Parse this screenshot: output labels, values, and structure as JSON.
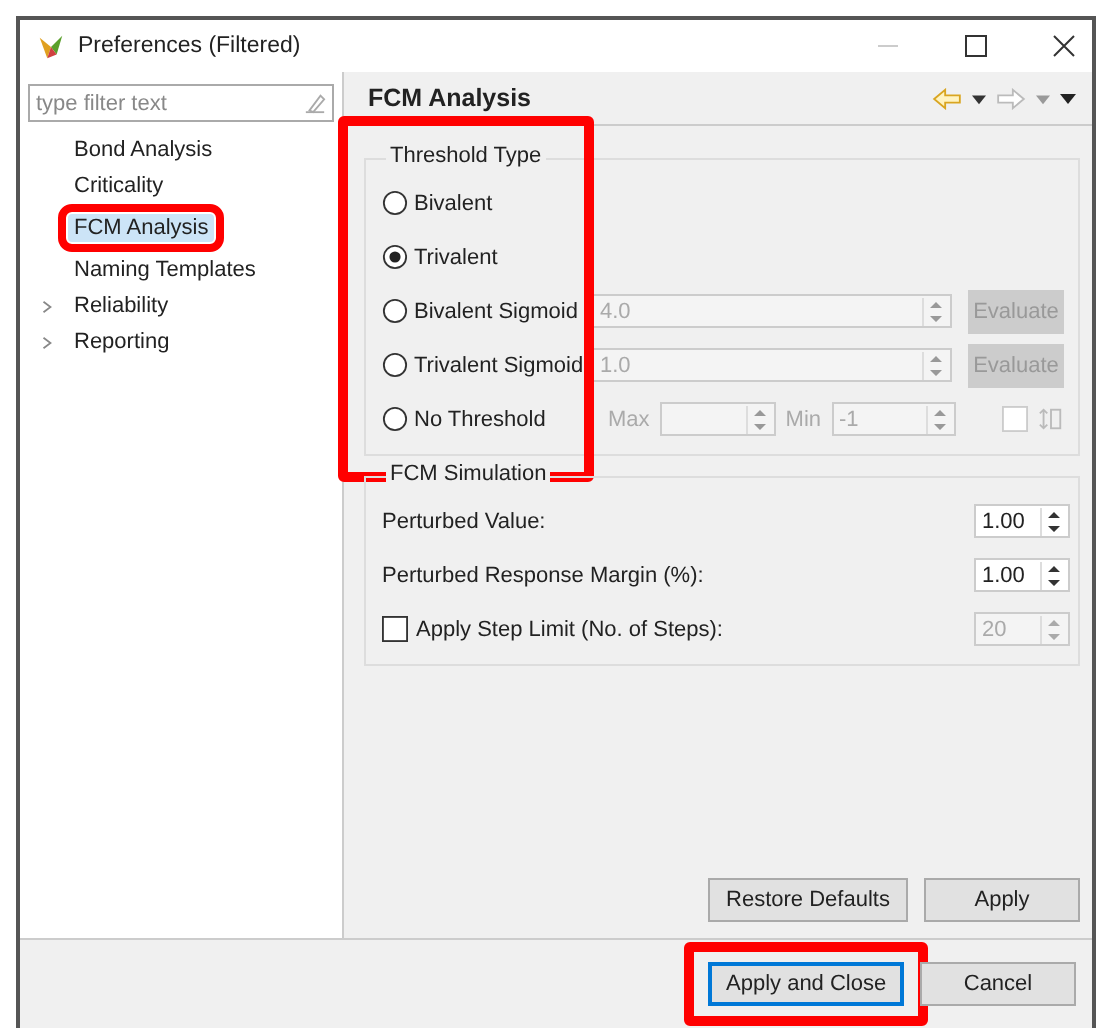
{
  "window": {
    "title": "Preferences (Filtered)"
  },
  "sidebar": {
    "filter": {
      "placeholder": "type filter text"
    },
    "items": [
      {
        "label": "Bond Analysis",
        "expandable": false,
        "selected": false,
        "highlighted": false
      },
      {
        "label": "Criticality",
        "expandable": false,
        "selected": false,
        "highlighted": false
      },
      {
        "label": "FCM Analysis",
        "expandable": false,
        "selected": true,
        "highlighted": true
      },
      {
        "label": "Naming Templates",
        "expandable": false,
        "selected": false,
        "highlighted": false
      },
      {
        "label": "Reliability",
        "expandable": true,
        "selected": false,
        "highlighted": false
      },
      {
        "label": "Reporting",
        "expandable": true,
        "selected": false,
        "highlighted": false
      }
    ]
  },
  "page": {
    "title": "FCM Analysis"
  },
  "threshold": {
    "title": "Threshold Type",
    "highlighted": true,
    "options": [
      {
        "kind": "plain",
        "label": "Bivalent",
        "selected": false
      },
      {
        "kind": "plain",
        "label": "Trivalent",
        "selected": true
      },
      {
        "kind": "spinner",
        "label": "Bivalent Sigmoid",
        "selected": false,
        "value": "4.0",
        "button": "Evaluate"
      },
      {
        "kind": "spinner",
        "label": "Trivalent Sigmoid",
        "selected": false,
        "value": "1.0",
        "button": "Evaluate"
      },
      {
        "kind": "range",
        "label": "No Threshold",
        "selected": false,
        "max_label": "Max",
        "min_label": "Min",
        "min_value": "-1",
        "checked": false
      }
    ]
  },
  "simulation": {
    "title": "FCM Simulation",
    "rows": [
      {
        "kind": "spinner",
        "label": "Perturbed Value:",
        "value": "1.00"
      },
      {
        "kind": "spinner",
        "label": "Perturbed Response Margin (%):",
        "value": "1.00"
      },
      {
        "kind": "checkbox",
        "label": "Apply Step Limit (No. of Steps):",
        "checked": false,
        "value": "20"
      }
    ]
  },
  "page_buttons": [
    "Restore Defaults",
    "Apply"
  ],
  "dialog_buttons": [
    {
      "label": "Apply and Close",
      "default": true,
      "highlighted": true
    },
    {
      "label": "Cancel",
      "default": false,
      "highlighted": false
    }
  ]
}
